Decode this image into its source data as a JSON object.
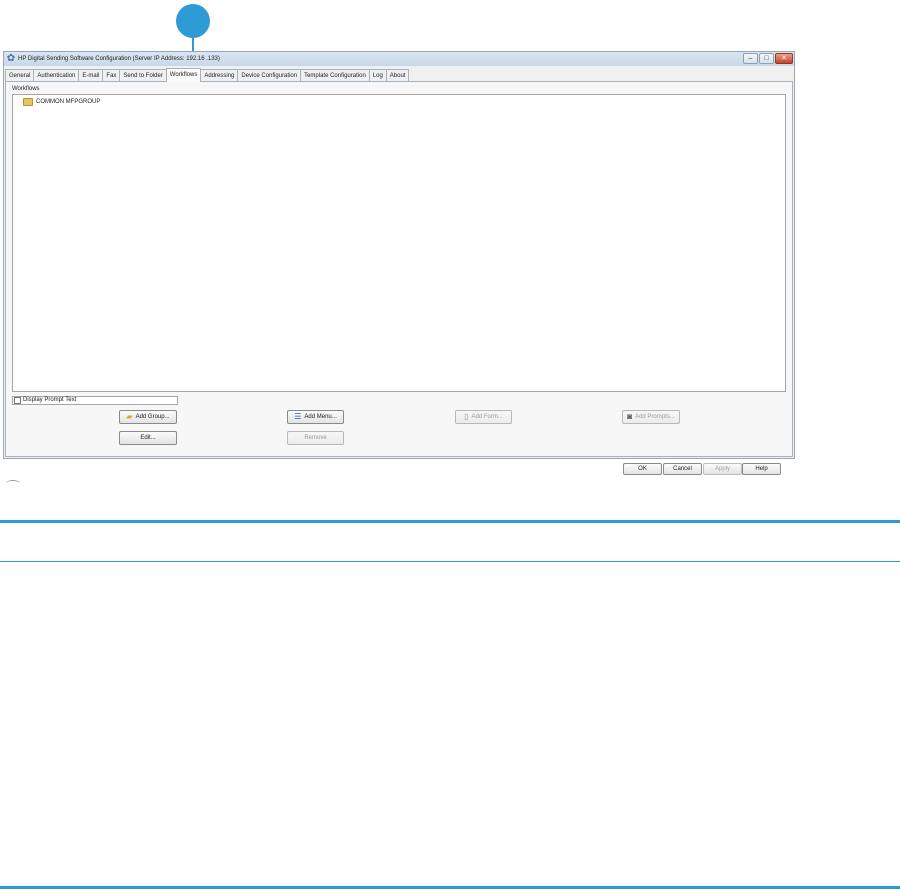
{
  "window": {
    "title": "HP Digital Sending Software Configuration (Server IP Address: 192.16   .133)",
    "controls": {
      "minimize": "–",
      "maximize": "□",
      "close": "✕"
    }
  },
  "tabs": [
    {
      "label": "General",
      "active": false
    },
    {
      "label": "Authentication",
      "active": false
    },
    {
      "label": "E-mail",
      "active": false
    },
    {
      "label": "Fax",
      "active": false
    },
    {
      "label": "Send to Folder",
      "active": false
    },
    {
      "label": "Workflows",
      "active": true
    },
    {
      "label": "Addressing",
      "active": false
    },
    {
      "label": "Device Configuration",
      "active": false
    },
    {
      "label": "Template Configuration",
      "active": false
    },
    {
      "label": "Log",
      "active": false
    },
    {
      "label": "About",
      "active": false
    }
  ],
  "workflows": {
    "section_label": "Workflows",
    "tree_items": [
      {
        "label": "COMMON MFPGROUP",
        "icon": "folder-icon"
      }
    ],
    "display_prompt_text": {
      "label": "Display Prompt Text",
      "checked": false
    }
  },
  "buttons": {
    "add_group": {
      "label": "Add Group...",
      "icon": "folder-icon",
      "enabled": true
    },
    "add_menu": {
      "label": "Add Menu...",
      "icon": "menu-icon",
      "enabled": true
    },
    "add_form": {
      "label": "Add Form...",
      "icon": "form-icon",
      "enabled": false
    },
    "add_prompts": {
      "label": "Add Prompts...",
      "icon": "prompt-icon",
      "enabled": false
    },
    "edit": {
      "label": "Edit...",
      "enabled": true
    },
    "remove": {
      "label": "Remove",
      "enabled": false
    }
  },
  "dialog_buttons": {
    "ok": "OK",
    "cancel": "Cancel",
    "apply": "Apply",
    "help": "Help"
  },
  "colors": {
    "accent": "#2f9bd6",
    "folder": "#e7c46a"
  }
}
